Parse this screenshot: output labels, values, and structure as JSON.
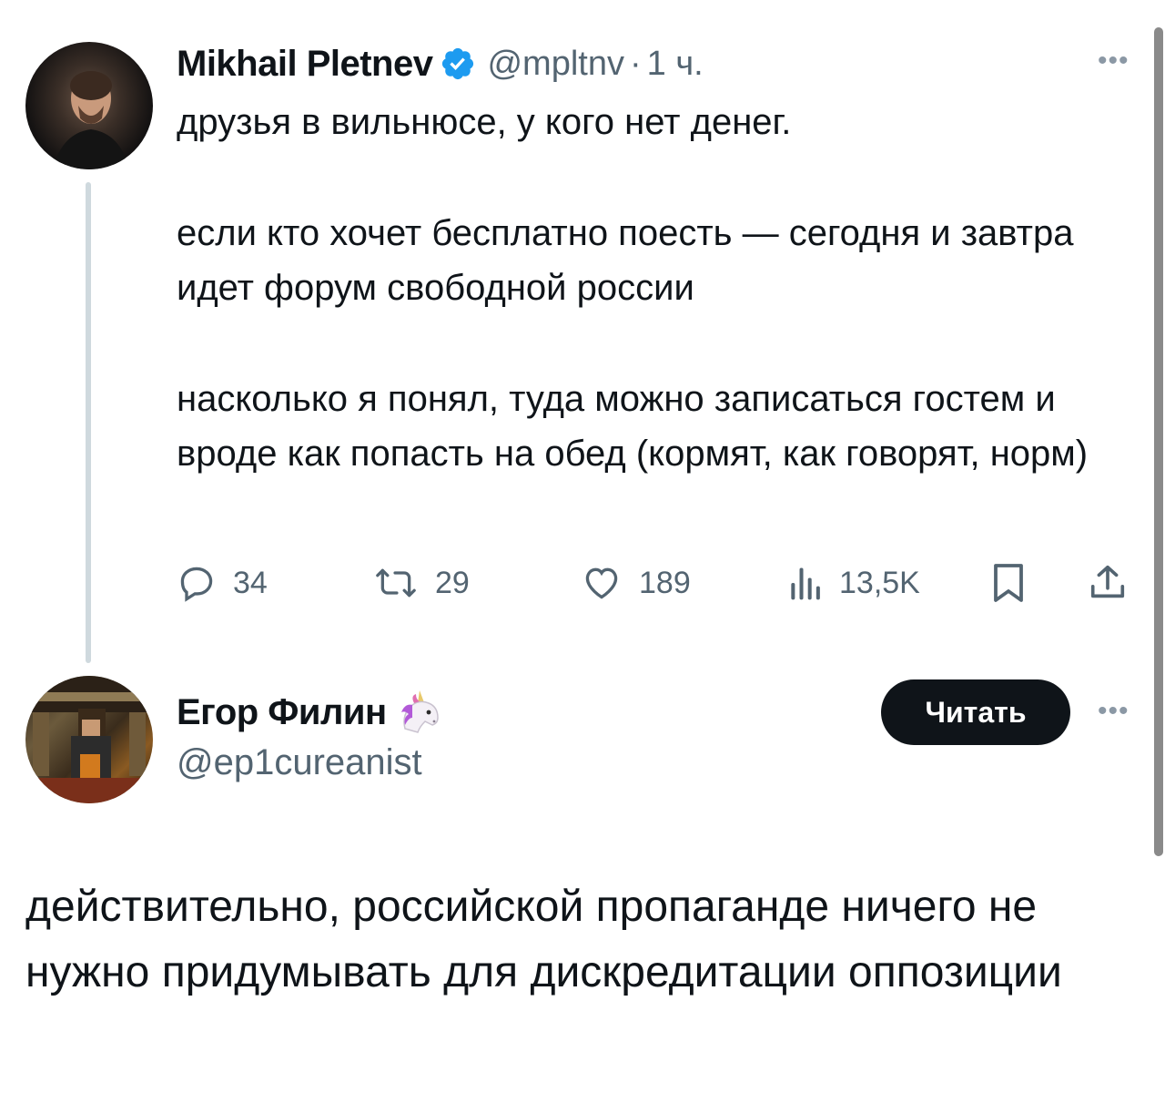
{
  "parent_tweet": {
    "author": {
      "display_name": "Mikhail Pletnev",
      "verified": true,
      "handle": "@mpltnv",
      "separator": "·",
      "time": "1 ч."
    },
    "paragraphs": [
      "друзья в вильнюсе, у кого нет денег.",
      "если кто хочет бесплатно поесть — сегодня и завтра идет форум свободной россии",
      "насколько я понял, туда можно записаться гостем и вроде как попасть на обед (кормят, как говорят, норм)"
    ],
    "actions": {
      "replies": "34",
      "retweets": "29",
      "likes": "189",
      "views": "13,5K"
    }
  },
  "reply_tweet": {
    "author": {
      "display_name": "Егор Филин",
      "handle": "@ep1cureanist"
    },
    "follow_label": "Читать",
    "text": "действительно, российской пропаганде ничего не нужно придумывать для дискредитации оппозиции"
  },
  "icons": {
    "more": "more-horizontal-icon",
    "verified": "verified-badge-icon",
    "reply": "reply-icon",
    "retweet": "retweet-icon",
    "like": "heart-icon",
    "views": "views-chart-icon",
    "bookmark": "bookmark-icon",
    "share": "share-icon",
    "unicorn": "unicorn-emoji-icon"
  },
  "colors": {
    "text_primary": "#0f1419",
    "text_secondary": "#536471",
    "verified_blue": "#1d9bf0",
    "thread_line": "#cfd9de",
    "follow_button_bg": "#0f1419"
  }
}
